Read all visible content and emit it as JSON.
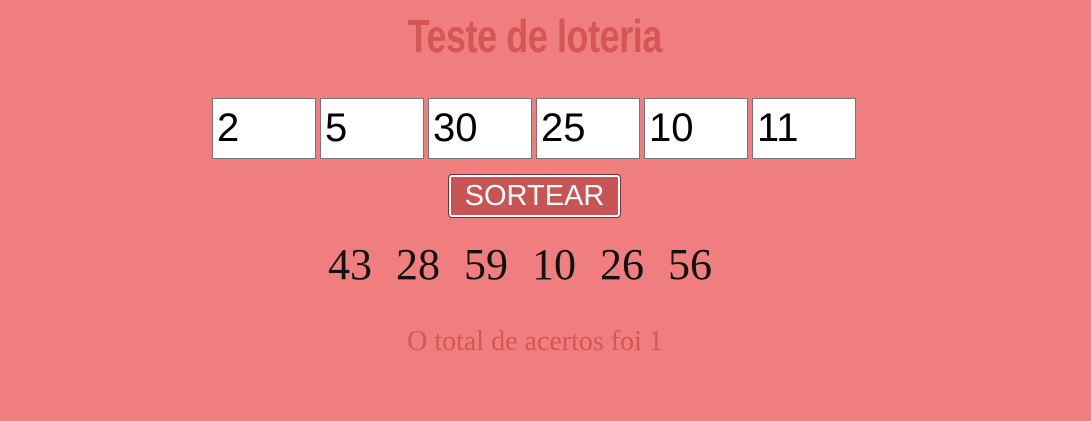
{
  "page": {
    "title": "Teste de loteria",
    "background_color": "#f07e7e",
    "accent_color": "#d65656"
  },
  "inputs": {
    "values": [
      "2",
      "5",
      "30",
      "25",
      "10",
      "11"
    ]
  },
  "draw_button": {
    "label": "SORTEAR"
  },
  "drawn_numbers": [
    "43",
    "28",
    "59",
    "10",
    "26",
    "56"
  ],
  "result": {
    "text": "O total de acertos foi 1"
  }
}
